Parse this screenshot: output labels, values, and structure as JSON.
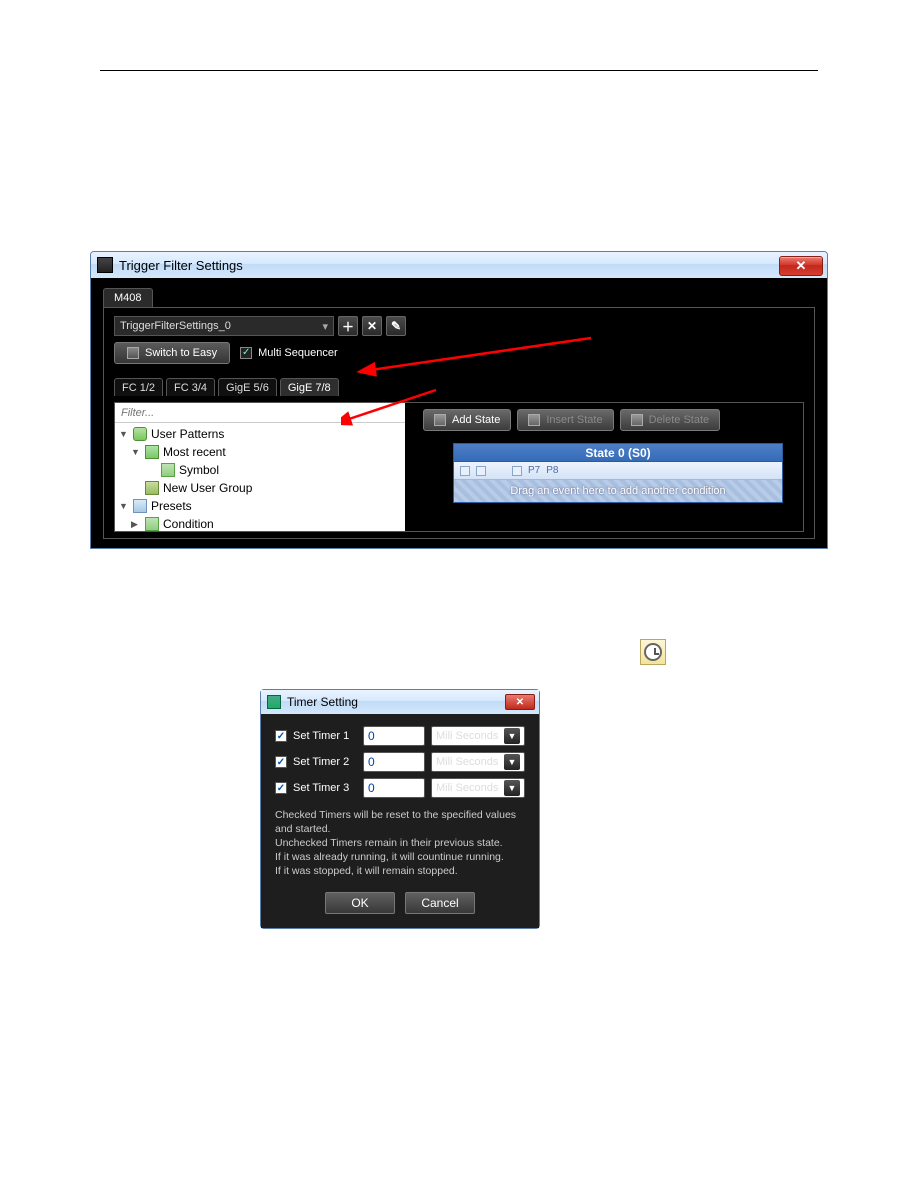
{
  "win1": {
    "title": "Trigger Filter Settings",
    "device_tab": "M408",
    "settings_name": "TriggerFilterSettings_0",
    "switch_button": "Switch to Easy",
    "multi_sequencer_label": "Multi Sequencer",
    "port_tabs": [
      "FC 1/2",
      "FC 3/4",
      "GigE 5/6",
      "GigE 7/8"
    ],
    "filter_placeholder": "Filter...",
    "tree": {
      "user_patterns": "User Patterns",
      "most_recent": "Most recent",
      "symbol": "Symbol",
      "new_user_group": "New User Group",
      "presets": "Presets",
      "condition": "Condition"
    },
    "state_buttons": {
      "add": "Add State",
      "insert": "Insert State",
      "delete": "Delete State"
    },
    "state_block": {
      "title": "State 0 (S0)",
      "pips": [
        "P7",
        "P8"
      ],
      "drop_hint": "Drag an event here to add another condition"
    }
  },
  "win2": {
    "title": "Timer Setting",
    "timers": [
      {
        "label": "Set Timer 1",
        "value": "0",
        "unit": "Mili Seconds"
      },
      {
        "label": "Set Timer 2",
        "value": "0",
        "unit": "Mili Seconds"
      },
      {
        "label": "Set Timer 3",
        "value": "0",
        "unit": "Mili Seconds"
      }
    ],
    "hint_line1": "Checked Timers will be reset to the specified values and started.",
    "hint_line2": "Unchecked Timers remain in their previous state.",
    "hint_line3": "If it was already running, it will countinue running.",
    "hint_line4": "If it was stopped, it will remain stopped.",
    "ok": "OK",
    "cancel": "Cancel"
  }
}
